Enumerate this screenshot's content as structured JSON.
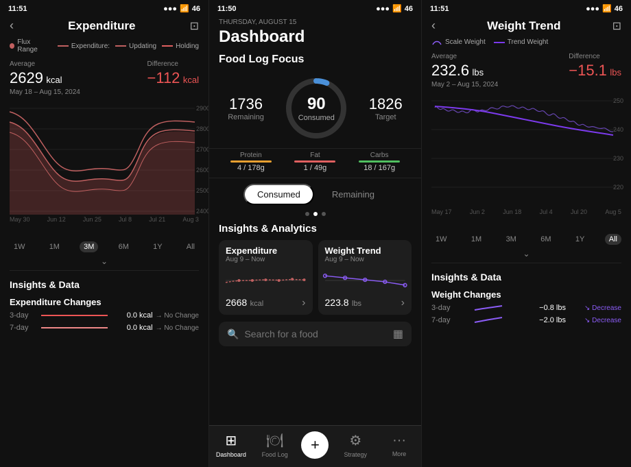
{
  "left_panel": {
    "status_time": "11:51",
    "title": "Expenditure",
    "legend": [
      {
        "label": "Flux Range",
        "type": "area",
        "color": "#c06060"
      },
      {
        "label": "Expenditure:",
        "type": "line",
        "color": "#c06060"
      },
      {
        "label": "Updating",
        "type": "line",
        "color": "#c06060"
      },
      {
        "label": "Holding",
        "type": "line",
        "color": "#e06060"
      }
    ],
    "average_label": "Average",
    "average_value": "2629",
    "average_unit": " kcal",
    "difference_label": "Difference",
    "difference_value": "−112",
    "difference_unit": " kcal",
    "date_range": "May 18 – Aug 15, 2024",
    "y_axis": [
      "2900",
      "2800",
      "2700",
      "2600",
      "2500",
      "2400"
    ],
    "x_axis": [
      "May 30",
      "Jun 12",
      "Jun 25",
      "Jul 8",
      "Jul 21",
      "Aug 3"
    ],
    "time_filters": [
      "1W",
      "1M",
      "3M",
      "6M",
      "1Y",
      "All"
    ],
    "active_filter": "3M",
    "insights_title": "Insights & Data",
    "changes_title": "Expenditure Changes",
    "changes": [
      {
        "period": "3-day",
        "value": "0.0 kcal",
        "change": "No Change"
      },
      {
        "period": "7-day",
        "value": "0.0 kcal",
        "change": "No Change"
      }
    ]
  },
  "center_panel": {
    "status_time": "11:50",
    "date_label": "THURSDAY, AUGUST 15",
    "title": "Dashboard",
    "food_log_title": "Food Log Focus",
    "remaining_label": "Remaining",
    "remaining_value": "1736",
    "consumed_label": "Consumed",
    "consumed_value": "90",
    "target_label": "Target",
    "target_value": "1826",
    "macros": [
      {
        "label": "Protein",
        "value": "4 / 178g",
        "color": "#e8a030"
      },
      {
        "label": "Fat",
        "value": "1 / 49g",
        "color": "#e06060"
      },
      {
        "label": "Carbs",
        "value": "18 / 167g",
        "color": "#50c060"
      }
    ],
    "toggle_consumed": "Consumed",
    "toggle_remaining": "Remaining",
    "analytics_title": "Insights & Analytics",
    "card1_title": "Expenditure",
    "card1_sub": "Aug 9 – Now",
    "card1_value": "2668",
    "card1_unit": "kcal",
    "card2_title": "Weight Trend",
    "card2_sub": "Aug 9 – Now",
    "card2_value": "223.8",
    "card2_unit": "lbs",
    "search_placeholder": "Search for a food",
    "nav_items": [
      "Dashboard",
      "Food Log",
      "",
      "Strategy",
      "More"
    ]
  },
  "right_panel": {
    "status_time": "11:51",
    "title": "Weight Trend",
    "legend": [
      {
        "label": "Scale Weight",
        "color": "#8b5cf6"
      },
      {
        "label": "Trend Weight",
        "color": "#7c3aed"
      }
    ],
    "average_label": "Average",
    "average_value": "232.6",
    "average_unit": " lbs",
    "difference_label": "Difference",
    "difference_value": "−15.1",
    "difference_unit": " lbs",
    "date_range": "May 2 – Aug 15, 2024",
    "y_axis": [
      "250",
      "240",
      "230",
      "220"
    ],
    "x_axis": [
      "May 17",
      "Jun 2",
      "Jun 18",
      "Jul 4",
      "Jul 20",
      "Aug 5"
    ],
    "time_filters": [
      "1W",
      "1M",
      "3M",
      "6M",
      "1Y",
      "All"
    ],
    "active_filter": "All",
    "insights_title": "Insights & Data",
    "changes_title": "Weight Changes",
    "changes": [
      {
        "period": "3-day",
        "value": "−0.8 lbs",
        "change": "Decrease"
      },
      {
        "period": "7-day",
        "value": "−2.0 lbs",
        "change": "Decrease"
      }
    ]
  }
}
